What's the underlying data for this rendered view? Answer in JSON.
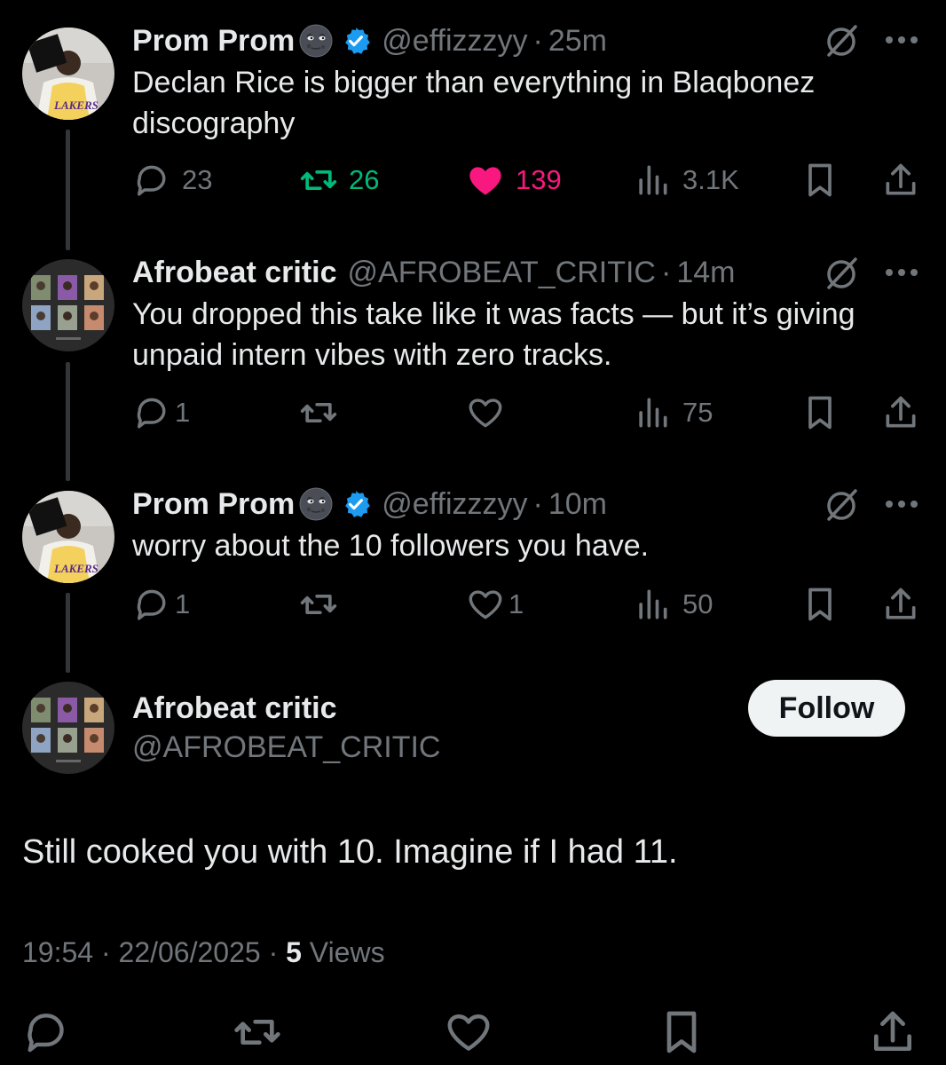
{
  "colors": {
    "retweet_active": "#00ba7c",
    "like_active": "#f91880",
    "muted": "#71767b",
    "verified": "#1d9bf0"
  },
  "tweets": [
    {
      "name": "Prom Prom",
      "emoji": "new-moon-face",
      "verified": true,
      "handle": "@effizzzyy",
      "dot": "·",
      "time": "25m",
      "text": "Declan Rice is bigger than everything in Blaqbonez discography",
      "replies": "23",
      "retweets": "26",
      "likes": "139",
      "views": "3.1K",
      "retweeted": true,
      "liked": true
    },
    {
      "name": "Afrobeat critic",
      "verified": false,
      "handle": "@AFROBEAT_CRITIC",
      "dot": "·",
      "time": "14m",
      "text": "You dropped this take like it was facts — but it’s giving unpaid intern vibes with zero tracks.",
      "replies": "1",
      "retweets": "",
      "likes": "",
      "views": "75"
    },
    {
      "name": "Prom Prom",
      "emoji": "new-moon-face",
      "verified": true,
      "handle": "@effizzzyy",
      "dot": "·",
      "time": "10m",
      "text": "worry about the 10 followers you have.",
      "replies": "1",
      "retweets": "",
      "likes": "1",
      "views": "50"
    }
  ],
  "main_tweet": {
    "name": "Afrobeat critic",
    "handle": "@AFROBEAT_CRITIC",
    "follow_label": "Follow",
    "text": "Still cooked you with 10. Imagine if I had 11.",
    "time": "19:54",
    "date": "22/06/2025",
    "dot": "·",
    "views_count": "5",
    "views_label": "Views"
  }
}
